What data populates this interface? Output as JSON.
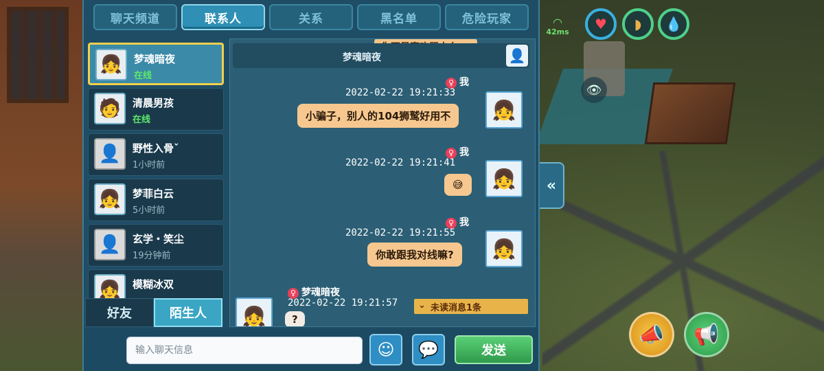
{
  "hud": {
    "ping": "42ms",
    "icons": [
      "wifi-icon",
      "heart-icon",
      "food-icon",
      "water-drop-icon",
      "eye-icon",
      "collapse-arrow-icon",
      "megaphone-gold-icon",
      "megaphone-green-icon"
    ],
    "accent": "#3ab0e0"
  },
  "tabs": [
    {
      "label": "聊天频道",
      "active": false
    },
    {
      "label": "联系人",
      "active": true
    },
    {
      "label": "关系",
      "active": false
    },
    {
      "label": "黑名单",
      "active": false
    },
    {
      "label": "危险玩家",
      "active": false
    }
  ],
  "contacts": [
    {
      "name": "梦魂暗夜",
      "status": "在线"
    },
    {
      "name": "清晨男孩",
      "status": "在线"
    },
    {
      "name": "野性入骨ˇ",
      "status": "1小时前"
    },
    {
      "name": "梦菲白云",
      "status": "5小时前"
    },
    {
      "name": "玄学・笑尘",
      "status": "19分钟前"
    },
    {
      "name": "模糊冰双",
      "status": ""
    }
  ],
  "subtabs": {
    "friends": "好友",
    "strangers": "陌生人"
  },
  "conversation": {
    "title": "梦魂暗夜",
    "partial_text": "你不是喜欢骂人么",
    "messages": [
      {
        "sender": "我",
        "time": "2022-02-22  19:21:33",
        "text": "小骗子，别人的104狮鹫好用不"
      },
      {
        "sender": "我",
        "time": "2022-02-22  19:21:41",
        "text": "😅"
      },
      {
        "sender": "我",
        "time": "2022-02-22  19:21:55",
        "text": "你敢跟我对线嘛?"
      },
      {
        "sender": "梦魂暗夜",
        "time": "2022-02-22  19:21:57",
        "text": "?"
      }
    ],
    "unread": "未读消息1条"
  },
  "input": {
    "placeholder": "输入聊天信息",
    "send_label": "发送"
  }
}
